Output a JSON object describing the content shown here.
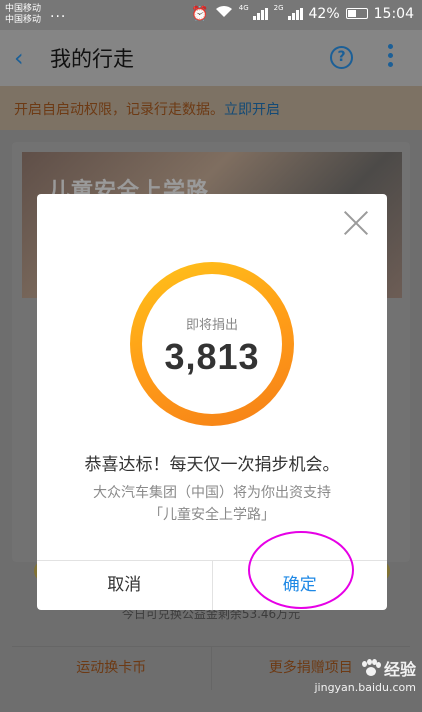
{
  "status_bar": {
    "carrier1": "中国移动",
    "carrier2": "中国移动",
    "dots": "...",
    "net1": "4G",
    "net2": "2G",
    "battery": "42%",
    "time": "15:04"
  },
  "header": {
    "back_icon": "‹",
    "title": "我的行走",
    "help_icon": "?"
  },
  "notice": {
    "text": "开启自启动权限，记录行走数据。",
    "link": "立即开启"
  },
  "card": {
    "banner_title": "儿童安全上学路",
    "remaining": "今日可兑换公益金剩余53.46万元",
    "actions": [
      "运动换卡币",
      "更多捐赠项目"
    ]
  },
  "dialog": {
    "ring_label": "即将捐出",
    "ring_value": "3,813",
    "congrats": "恭喜达标！每天仅一次捐步机会。",
    "sponsor": "大众汽车集团（中国）将为你出资支持",
    "project": "「儿童安全上学路」",
    "cancel_label": "取消",
    "ok_label": "确定"
  },
  "watermark": {
    "main": "经验",
    "sub": "jingyan.baidu.com"
  },
  "colors": {
    "accent_blue": "#1e88e5",
    "ring_orange": "#f57f17",
    "annotation_magenta": "#e600e6"
  }
}
